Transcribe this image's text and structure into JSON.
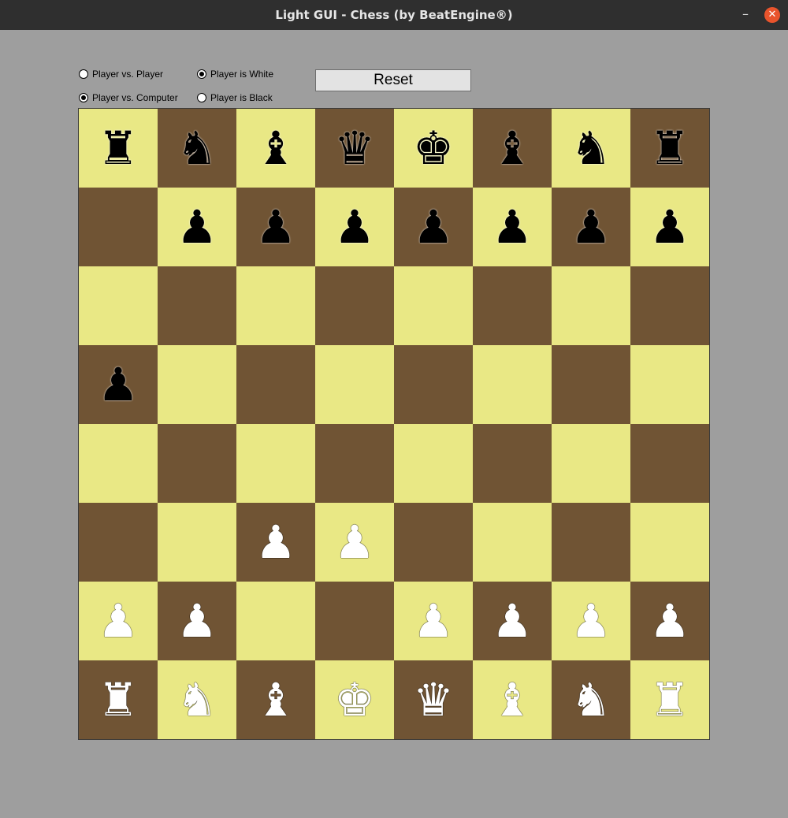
{
  "window": {
    "title": "Light GUI - Chess (by BeatEngine®)",
    "minimize_glyph": "–",
    "close_glyph": "✕"
  },
  "options": {
    "mode_pvp": "Player vs. Player",
    "mode_pvc": "Player vs. Computer",
    "side_white": "Player is White",
    "side_black": "Player is Black",
    "selected_mode": "pvc",
    "selected_side": "white"
  },
  "reset_label": "Reset",
  "board": {
    "light_color": "#e9e885",
    "dark_color": "#705434",
    "ranks": [
      [
        "bR",
        "bN",
        "bB",
        "bQ",
        "bK",
        "bB",
        "bN",
        "bR"
      ],
      [
        "",
        "bP",
        "bP",
        "bP",
        "bP",
        "bP",
        "bP",
        "bP"
      ],
      [
        "",
        "",
        "",
        "",
        "",
        "",
        "",
        ""
      ],
      [
        "bP",
        "",
        "",
        "",
        "",
        "",
        "",
        ""
      ],
      [
        "",
        "",
        "",
        "",
        "",
        "",
        "",
        ""
      ],
      [
        "",
        "",
        "wP",
        "wP",
        "",
        "",
        "",
        ""
      ],
      [
        "wP",
        "wP",
        "",
        "",
        "wP",
        "wP",
        "wP",
        "wP"
      ],
      [
        "wR",
        "wN",
        "wB",
        "wK",
        "wQ",
        "wB",
        "wN",
        "wR"
      ]
    ]
  }
}
